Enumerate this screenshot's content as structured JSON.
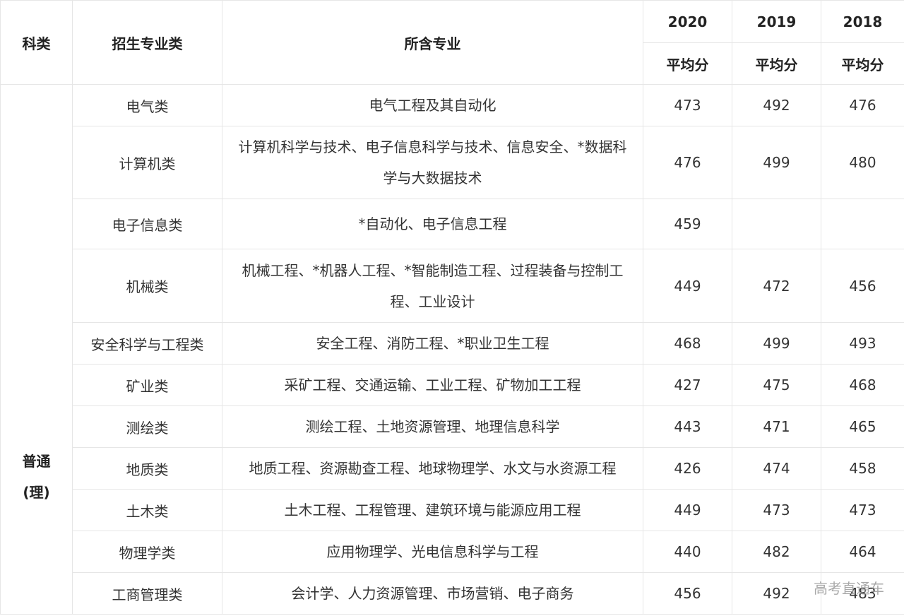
{
  "header": {
    "category": "科类",
    "enroll_class": "招生专业类",
    "majors": "所含专业",
    "years": [
      "2020",
      "2019",
      "2018"
    ],
    "avg_label": "平均分"
  },
  "side_category": {
    "line1": "普通",
    "line2": "(理)"
  },
  "rows": [
    {
      "enroll_class": "电气类",
      "majors": "电气工程及其自动化",
      "scores": [
        "473",
        "492",
        "476"
      ]
    },
    {
      "enroll_class": "计算机类",
      "majors": "计算机科学与技术、电子信息科学与技术、信息安全、*数据科学与大数据技术",
      "scores": [
        "476",
        "499",
        "480"
      ]
    },
    {
      "enroll_class": "电子信息类",
      "majors": "*自动化、电子信息工程",
      "scores": [
        "459",
        "",
        ""
      ]
    },
    {
      "enroll_class": "机械类",
      "majors": "机械工程、*机器人工程、*智能制造工程、过程装备与控制工程、工业设计",
      "scores": [
        "449",
        "472",
        "456"
      ]
    },
    {
      "enroll_class": "安全科学与工程类",
      "majors": "安全工程、消防工程、*职业卫生工程",
      "scores": [
        "468",
        "499",
        "493"
      ]
    },
    {
      "enroll_class": "矿业类",
      "majors": "采矿工程、交通运输、工业工程、矿物加工工程",
      "scores": [
        "427",
        "475",
        "468"
      ]
    },
    {
      "enroll_class": "测绘类",
      "majors": "测绘工程、土地资源管理、地理信息科学",
      "scores": [
        "443",
        "471",
        "465"
      ]
    },
    {
      "enroll_class": "地质类",
      "majors": "地质工程、资源勘查工程、地球物理学、水文与水资源工程",
      "scores": [
        "426",
        "474",
        "458"
      ]
    },
    {
      "enroll_class": "土木类",
      "majors": "土木工程、工程管理、建筑环境与能源应用工程",
      "scores": [
        "449",
        "473",
        "473"
      ]
    },
    {
      "enroll_class": "物理学类",
      "majors": "应用物理学、光电信息科学与工程",
      "scores": [
        "440",
        "482",
        "464"
      ]
    },
    {
      "enroll_class": "工商管理类",
      "majors": "会计学、人力资源管理、市场营销、电子商务",
      "scores": [
        "456",
        "492",
        "483"
      ]
    }
  ],
  "watermark": "高考直通车"
}
